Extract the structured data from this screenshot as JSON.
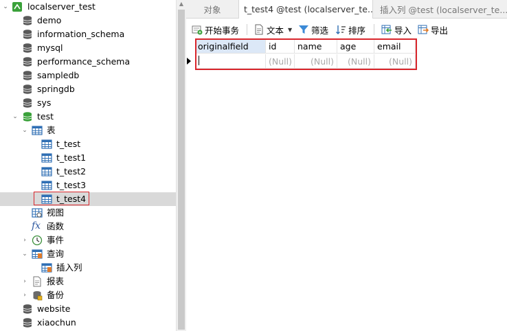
{
  "sidebar": {
    "connection": "localserver_test",
    "databases_top": [
      "demo",
      "information_schema",
      "mysql",
      "performance_schema",
      "sampledb",
      "springdb",
      "sys"
    ],
    "open_db": "test",
    "tables_group": "表",
    "tables": [
      "t_test",
      "t_test1",
      "t_test2",
      "t_test3",
      "t_test4"
    ],
    "views_group": "视图",
    "functions_group": "函数",
    "events_group": "事件",
    "queries_group": "查询",
    "query_item": "插入列",
    "reports_group": "报表",
    "backup_group": "备份",
    "databases_bottom": [
      "website",
      "xiaochun"
    ]
  },
  "tabs": [
    {
      "label": "对象"
    },
    {
      "label": "t_test4 @test (localserver_te..."
    },
    {
      "label": "插入列 @test (localserver_te..."
    }
  ],
  "toolbar": {
    "begin_tx": "开始事务",
    "text": "文本",
    "filter": "筛选",
    "sort": "排序",
    "import": "导入",
    "export": "导出"
  },
  "grid": {
    "columns": [
      "originalfield",
      "id",
      "name",
      "age",
      "email"
    ],
    "row": [
      "",
      "(Null)",
      "(Null)",
      "(Null)",
      "(Null)"
    ]
  },
  "colors": {
    "db_icon": "#5a5a5a",
    "db_icon_active": "#3aa13a",
    "table_icon": "#2f6fb4",
    "highlight": "#d9252b",
    "selected_row": "#d9d9d9",
    "header_active": "#dce8f7"
  }
}
